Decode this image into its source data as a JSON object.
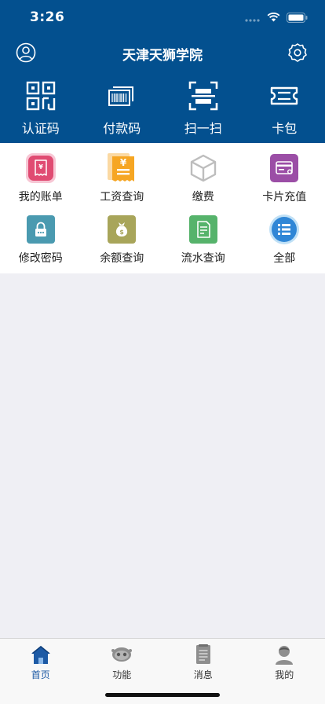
{
  "status_bar": {
    "time": "3:26"
  },
  "header": {
    "title": "天津天狮学院"
  },
  "quick_actions": [
    {
      "label": "认证码",
      "icon": "qr-code-icon"
    },
    {
      "label": "付款码",
      "icon": "barcode-icon"
    },
    {
      "label": "扫一扫",
      "icon": "scan-icon"
    },
    {
      "label": "卡包",
      "icon": "card-wallet-icon"
    }
  ],
  "services": [
    {
      "label": "我的账单",
      "icon": "bill-icon",
      "color": "#e04b72"
    },
    {
      "label": "工资查询",
      "icon": "salary-icon",
      "color": "#f6a623"
    },
    {
      "label": "缴费",
      "icon": "cube-icon",
      "color": "#bdbdbd"
    },
    {
      "label": "卡片充值",
      "icon": "card-recharge-icon",
      "color": "#9b4ea6"
    },
    {
      "label": "修改密码",
      "icon": "lock-icon",
      "color": "#4a9ab0"
    },
    {
      "label": "余额查询",
      "icon": "money-bag-icon",
      "color": "#a8a55a"
    },
    {
      "label": "流水查询",
      "icon": "document-icon",
      "color": "#56b36b"
    },
    {
      "label": "全部",
      "icon": "list-icon",
      "color": "#2f86d6"
    }
  ],
  "tabbar": [
    {
      "label": "首页",
      "icon": "home-icon",
      "active": true
    },
    {
      "label": "功能",
      "icon": "robot-icon",
      "active": false
    },
    {
      "label": "消息",
      "icon": "message-icon",
      "active": false
    },
    {
      "label": "我的",
      "icon": "profile-icon",
      "active": false
    }
  ],
  "colors": {
    "header_bg": "#03508f",
    "active_tab": "#1d5aa5",
    "page_bg": "#efeff4"
  }
}
